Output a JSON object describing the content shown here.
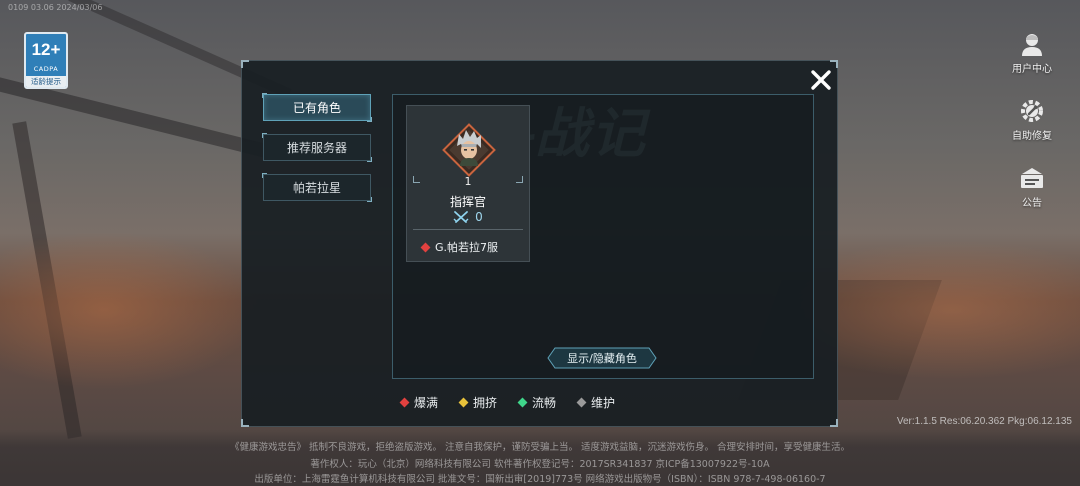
{
  "top_status_text": "0109 03.06 2024/03/06",
  "age_badge": {
    "rating": "12+",
    "org": "CADPA",
    "tip": "适龄提示"
  },
  "side_menu": [
    {
      "label": "用户中心",
      "icon": "user-icon"
    },
    {
      "label": "自助修复",
      "icon": "repair-gear-icon"
    },
    {
      "label": "公告",
      "icon": "announcement-icon"
    }
  ],
  "dialog": {
    "close_icon": "close-icon",
    "watermark": "格斗战记",
    "tabs": [
      {
        "label": "已有角色",
        "active": true
      },
      {
        "label": "推荐服务器",
        "active": false
      },
      {
        "label": "帕若拉星",
        "active": false
      }
    ],
    "character": {
      "level": "1",
      "name": "指挥官",
      "power": "0",
      "server": "G.帕若拉7服",
      "server_status_color": "#e2413f"
    },
    "toggle_label": "显示/隐藏角色",
    "legend": [
      {
        "label": "爆满",
        "color": "#e2413f"
      },
      {
        "label": "拥挤",
        "color": "#e8c23a"
      },
      {
        "label": "流畅",
        "color": "#3fd68a"
      },
      {
        "label": "维护",
        "color": "#9a9a9a"
      }
    ]
  },
  "version": "Ver:1.1.5 Res:06.20.362 Pkg:06.12.135",
  "footer": {
    "line1": "《健康游戏忠告》 抵制不良游戏，拒绝盗版游戏。 注意自我保护，谨防受骗上当。 适度游戏益脑，沉迷游戏伤身。 合理安排时间，享受健康生活。",
    "line2": "著作权人：玩心（北京）网络科技有限公司   软件著作权登记号：2017SR341837   京ICP备13007922号-10A",
    "line3": "出版单位：上海雷霆鱼计算机科技有限公司 批准文号：国新出审[2019]773号 网络游戏出版物号（ISBN）：ISBN 978-7-498-06160-7"
  }
}
